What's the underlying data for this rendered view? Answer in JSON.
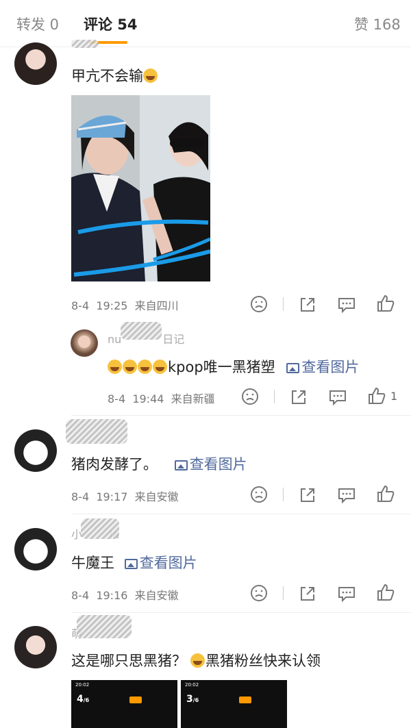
{
  "tabs": {
    "repost": "转发 0",
    "comment": "评论 54",
    "like": "赞 168"
  },
  "comments": [
    {
      "text": "甲亢不会输",
      "time": "8-4",
      "clock": "19:25",
      "source": "来自四川"
    },
    {
      "reply_user_prefix": "nu",
      "reply_user_suffix": "日记",
      "reply_text": "kpop唯一黑猪塑",
      "reply_link": "查看图片",
      "reply_time": "8-4",
      "reply_clock": "19:44",
      "reply_source": "来自新疆",
      "reply_likes": "1"
    },
    {
      "text": "猪肉发酵了。",
      "link": "查看图片",
      "time": "8-4",
      "clock": "19:17",
      "source": "来自安徽"
    },
    {
      "user_prefix": "小",
      "user_suffix": "la",
      "text": "牛魔王",
      "link": "查看图片",
      "time": "8-4",
      "clock": "19:16",
      "source": "来自安徽"
    },
    {
      "user_prefix": "萌",
      "text": "这是哪只思黑猪？",
      "text2": "黑猪粉丝快来认领"
    }
  ],
  "thumbs": [
    {
      "status_time": "20:02",
      "page": "4",
      "total": "/6"
    },
    {
      "status_time": "20:02",
      "page": "3",
      "total": "/6"
    }
  ]
}
